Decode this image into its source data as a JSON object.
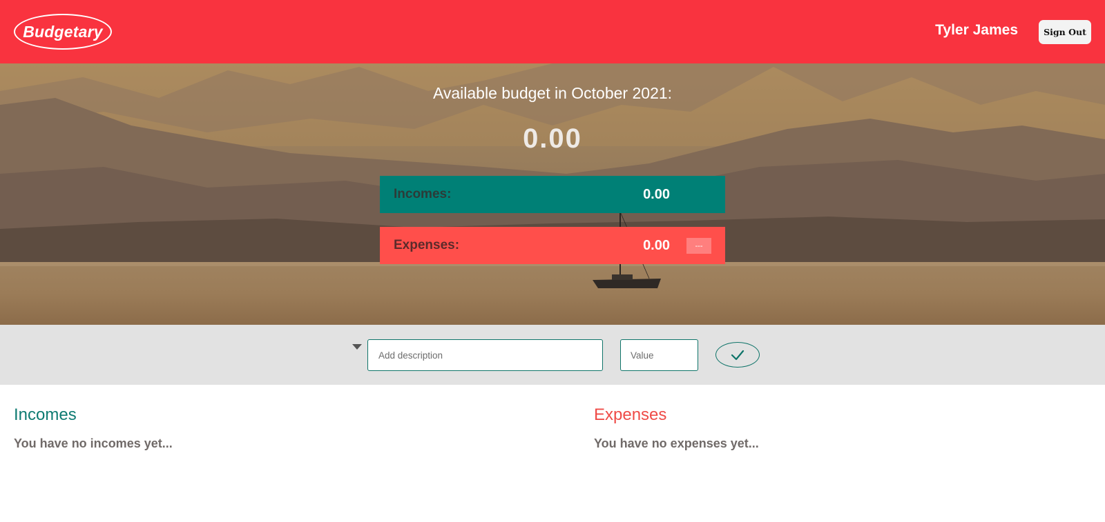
{
  "header": {
    "logo": "Budgetary",
    "user_name": "Tyler James",
    "sign_out_label": "Sign Out"
  },
  "budget": {
    "title": "Available budget in October 2021:",
    "value": "0.00",
    "incomes_label": "Incomes:",
    "incomes_value": "0.00",
    "expenses_label": "Expenses:",
    "expenses_value": "0.00",
    "expenses_percent": "---"
  },
  "add_form": {
    "description_placeholder": "Add description",
    "value_placeholder": "Value"
  },
  "lists": {
    "incomes_title": "Incomes",
    "incomes_empty": "You have no incomes yet...",
    "expenses_title": "Expenses",
    "expenses_empty": "You have no expenses yet..."
  },
  "colors": {
    "header": "#f9333f",
    "income": "#008076",
    "expense": "#ff4f4b",
    "add_bar": "#e2e2e2"
  },
  "icons": {
    "type_select": "caret-down-icon",
    "confirm": "check-icon",
    "hero": "sailboat-landscape"
  }
}
